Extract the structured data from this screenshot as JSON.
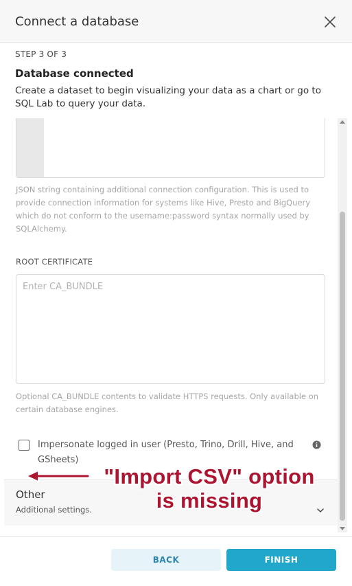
{
  "modal": {
    "title": "Connect a database",
    "close_icon": "close-icon"
  },
  "step": {
    "label": "STEP 3 OF 3",
    "title": "Database connected",
    "description": "Create a dataset to begin visualizing your data as a chart or go to SQL Lab to query your data."
  },
  "form": {
    "extra_help": "JSON string containing additional connection configuration. This is used to provide connection information for systems like Hive, Presto and BigQuery which do not conform to the username:password syntax normally used by SQLAlchemy.",
    "root_cert_label": "ROOT CERTIFICATE",
    "root_cert_placeholder": "Enter CA_BUNDLE",
    "root_cert_help": "Optional CA_BUNDLE contents to validate HTTPS requests. Only available on certain database engines.",
    "impersonate_label": "Impersonate logged in user (Presto, Trino, Drill, Hive, and GSheets)",
    "impersonate_checked": false,
    "info_icon": "info-icon"
  },
  "other": {
    "title": "Other",
    "subtitle": "Additional settings.",
    "chevron_icon": "chevron-down-icon"
  },
  "footer": {
    "back_label": "BACK",
    "finish_label": "FINISH"
  },
  "annotation": {
    "text": "\"Import CSV\" option is missing"
  },
  "colors": {
    "primary": "#20a7c9",
    "secondary_bg": "#e6f3f8",
    "annotation": "#ad1430"
  }
}
